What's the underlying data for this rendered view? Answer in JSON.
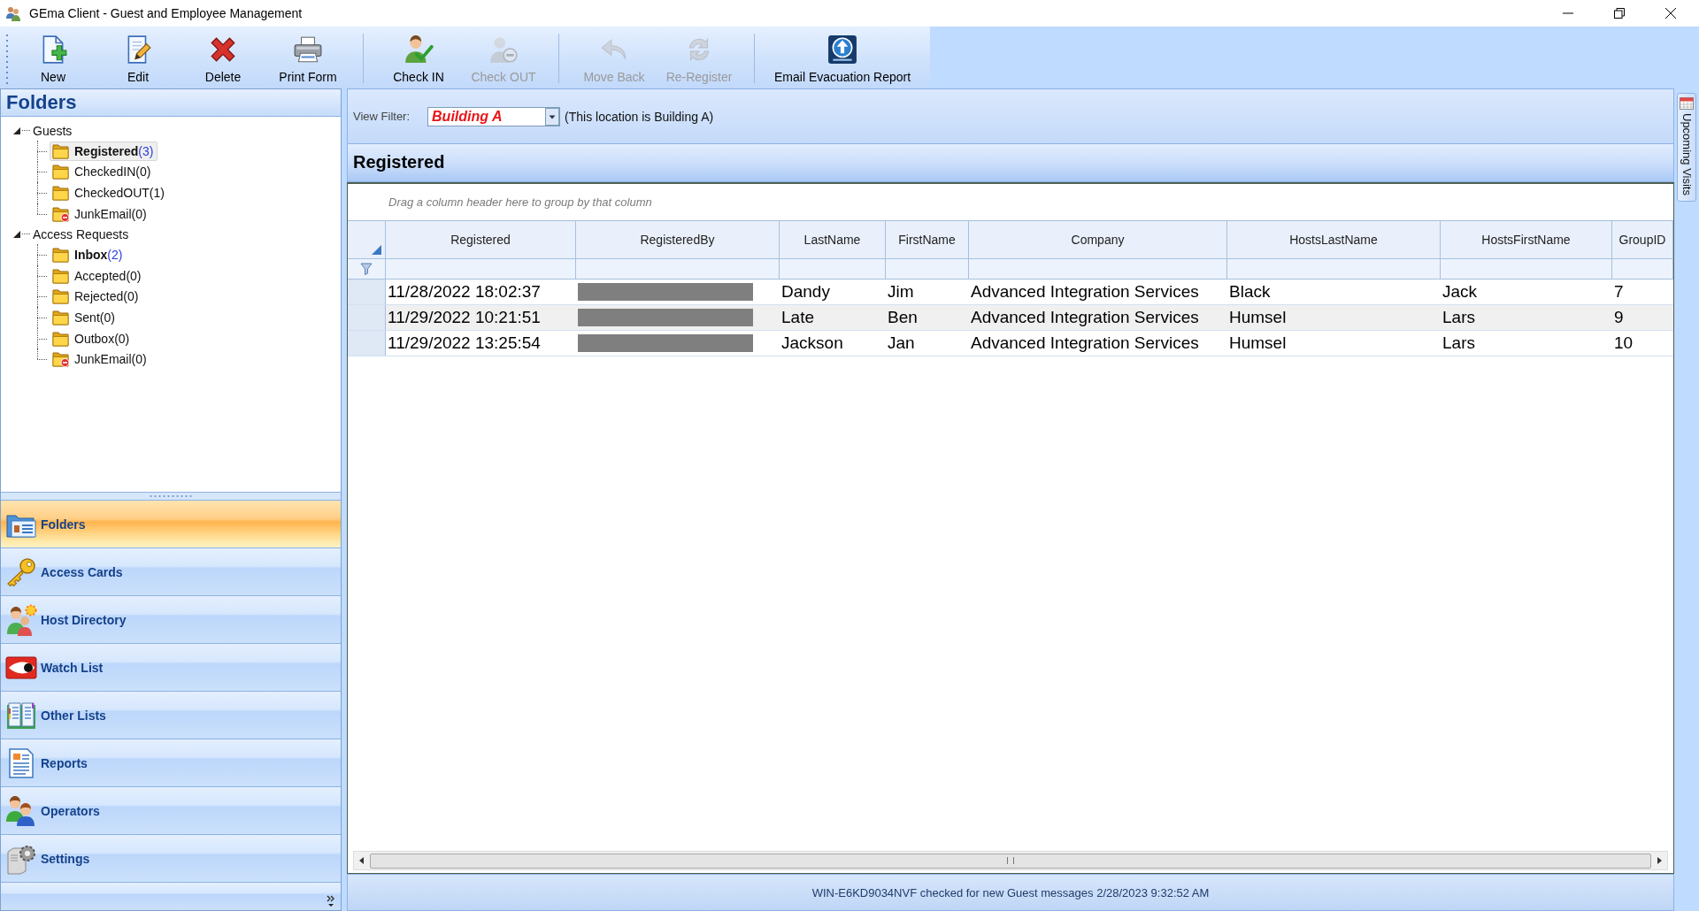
{
  "window": {
    "title": "GEma Client - Guest and Employee Management"
  },
  "toolbar": {
    "groups": [
      [
        {
          "kind": "new",
          "label": "New",
          "disabled": false
        },
        {
          "kind": "edit",
          "label": "Edit",
          "disabled": false
        },
        {
          "kind": "delete",
          "label": "Delete",
          "disabled": false
        },
        {
          "kind": "print",
          "label": "Print Form",
          "disabled": false
        }
      ],
      [
        {
          "kind": "check-in",
          "label": "Check IN",
          "disabled": false
        },
        {
          "kind": "check-out",
          "label": "Check OUT",
          "disabled": true
        }
      ],
      [
        {
          "kind": "move-back",
          "label": "Move Back",
          "disabled": true
        },
        {
          "kind": "re-register",
          "label": "Re-Register",
          "disabled": true
        }
      ],
      [
        {
          "kind": "evacuation",
          "label": "Email Evacuation Report",
          "disabled": false
        }
      ]
    ]
  },
  "sidebar": {
    "title": "Folders",
    "tree": [
      {
        "label": "Guests",
        "expanded": true,
        "children": [
          {
            "kind": "folder",
            "name": "Registered",
            "count": "(3)",
            "unread": true,
            "selected": true
          },
          {
            "kind": "folder",
            "name": "CheckedIN",
            "count": "(0)",
            "unread": false,
            "selected": false
          },
          {
            "kind": "folder",
            "name": "CheckedOUT",
            "count": "(1)",
            "unread": false,
            "selected": false
          },
          {
            "kind": "junk",
            "name": "JunkEmail",
            "count": "(0)",
            "unread": false,
            "selected": false
          }
        ]
      },
      {
        "label": "Access Requests",
        "expanded": true,
        "children": [
          {
            "kind": "folder",
            "name": "Inbox",
            "count": "(2)",
            "unread": true,
            "selected": false
          },
          {
            "kind": "folder",
            "name": "Accepted",
            "count": "(0)",
            "unread": false,
            "selected": false
          },
          {
            "kind": "folder",
            "name": "Rejected",
            "count": "(0)",
            "unread": false,
            "selected": false
          },
          {
            "kind": "folder",
            "name": "Sent",
            "count": "(0)",
            "unread": false,
            "selected": false
          },
          {
            "kind": "folder",
            "name": "Outbox",
            "count": "(0)",
            "unread": false,
            "selected": false
          },
          {
            "kind": "junk",
            "name": "JunkEmail",
            "count": "(0)",
            "unread": false,
            "selected": false
          }
        ]
      }
    ],
    "nav": [
      {
        "kind": "folders",
        "label": "Folders",
        "selected": true
      },
      {
        "kind": "access-cards",
        "label": "Access Cards",
        "selected": false
      },
      {
        "kind": "host-directory",
        "label": "Host Directory",
        "selected": false
      },
      {
        "kind": "watch-list",
        "label": "Watch List",
        "selected": false
      },
      {
        "kind": "other-lists",
        "label": "Other Lists",
        "selected": false
      },
      {
        "kind": "reports",
        "label": "Reports",
        "selected": false
      },
      {
        "kind": "operators",
        "label": "Operators",
        "selected": false
      },
      {
        "kind": "settings",
        "label": "Settings",
        "selected": false
      }
    ]
  },
  "view_filter": {
    "label": "View Filter:",
    "value": "Building A",
    "note": "(This location is Building A)"
  },
  "grid": {
    "title": "Registered",
    "group_hint": "Drag a column header here to group by that column",
    "columns": [
      "Registered",
      "RegisteredBy",
      "LastName",
      "FirstName",
      "Company",
      "HostsLastName",
      "HostsFirstName",
      "GroupID"
    ],
    "rows": [
      {
        "cells": [
          {
            "kind": "text",
            "text": "11/28/2022 18:02:37"
          },
          {
            "kind": "redacted"
          },
          {
            "kind": "text",
            "text": "Dandy"
          },
          {
            "kind": "text",
            "text": "Jim"
          },
          {
            "kind": "text",
            "text": "Advanced Integration Services"
          },
          {
            "kind": "text",
            "text": "Black"
          },
          {
            "kind": "text",
            "text": "Jack"
          },
          {
            "kind": "text",
            "text": "7"
          }
        ]
      },
      {
        "cells": [
          {
            "kind": "text",
            "text": "11/29/2022 10:21:51"
          },
          {
            "kind": "redacted"
          },
          {
            "kind": "text",
            "text": "Late"
          },
          {
            "kind": "text",
            "text": "Ben"
          },
          {
            "kind": "text",
            "text": "Advanced Integration Services"
          },
          {
            "kind": "text",
            "text": "Humsel"
          },
          {
            "kind": "text",
            "text": "Lars"
          },
          {
            "kind": "text",
            "text": "9"
          }
        ]
      },
      {
        "cells": [
          {
            "kind": "text",
            "text": "11/29/2022 13:25:54"
          },
          {
            "kind": "redacted"
          },
          {
            "kind": "text",
            "text": "Jackson"
          },
          {
            "kind": "text",
            "text": "Jan"
          },
          {
            "kind": "text",
            "text": "Advanced Integration Services"
          },
          {
            "kind": "text",
            "text": "Humsel"
          },
          {
            "kind": "text",
            "text": "Lars"
          },
          {
            "kind": "text",
            "text": "10"
          }
        ]
      }
    ]
  },
  "side_tab": {
    "label": "Upcoming Visits"
  },
  "status_bar": {
    "text": "WIN-E6KD9034NVF checked for new Guest messages 2/28/2023 9:32:52 AM"
  }
}
